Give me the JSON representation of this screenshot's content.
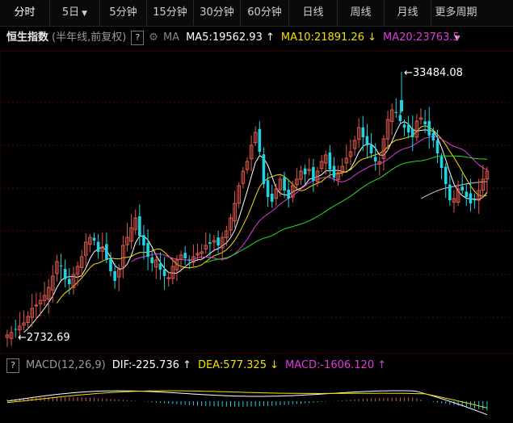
{
  "tabs": [
    {
      "label": "分时"
    },
    {
      "label": "5日",
      "dropdown": true
    },
    {
      "label": "5分钟"
    },
    {
      "label": "15分钟"
    },
    {
      "label": "30分钟"
    },
    {
      "label": "60分钟"
    },
    {
      "label": "日线"
    },
    {
      "label": "周线"
    },
    {
      "label": "月线"
    },
    {
      "label": "更多周期",
      "dropdown": true
    }
  ],
  "header": {
    "title": "恒生指数",
    "subtitle": "(半年线,前复权)",
    "help": "?",
    "ma_label": "MA",
    "ma5": "MA5:19562.93",
    "ma5_arrow": "↑",
    "ma10": "MA10:21891.26",
    "ma10_arrow": "↓",
    "ma20": "MA20:23763.5"
  },
  "chart_data": {
    "type": "candlestick",
    "high_label": "33484.08",
    "low_label": "2732.69",
    "colors": {
      "up": "#e0584c",
      "down": "#1fd3e0",
      "ma5": "#ffffff",
      "ma10": "#f5e000",
      "ma20": "#e03ae0",
      "ma40": "#22dd22",
      "ma60": "#cccccc"
    }
  },
  "macd": {
    "help": "?",
    "label": "MACD(12,26,9)",
    "dif": "DIF:-225.736",
    "dif_arrow": "↑",
    "dea": "DEA:577.325",
    "dea_arrow": "↓",
    "macd": "MACD:-1606.120",
    "macd_arrow": "↑"
  }
}
